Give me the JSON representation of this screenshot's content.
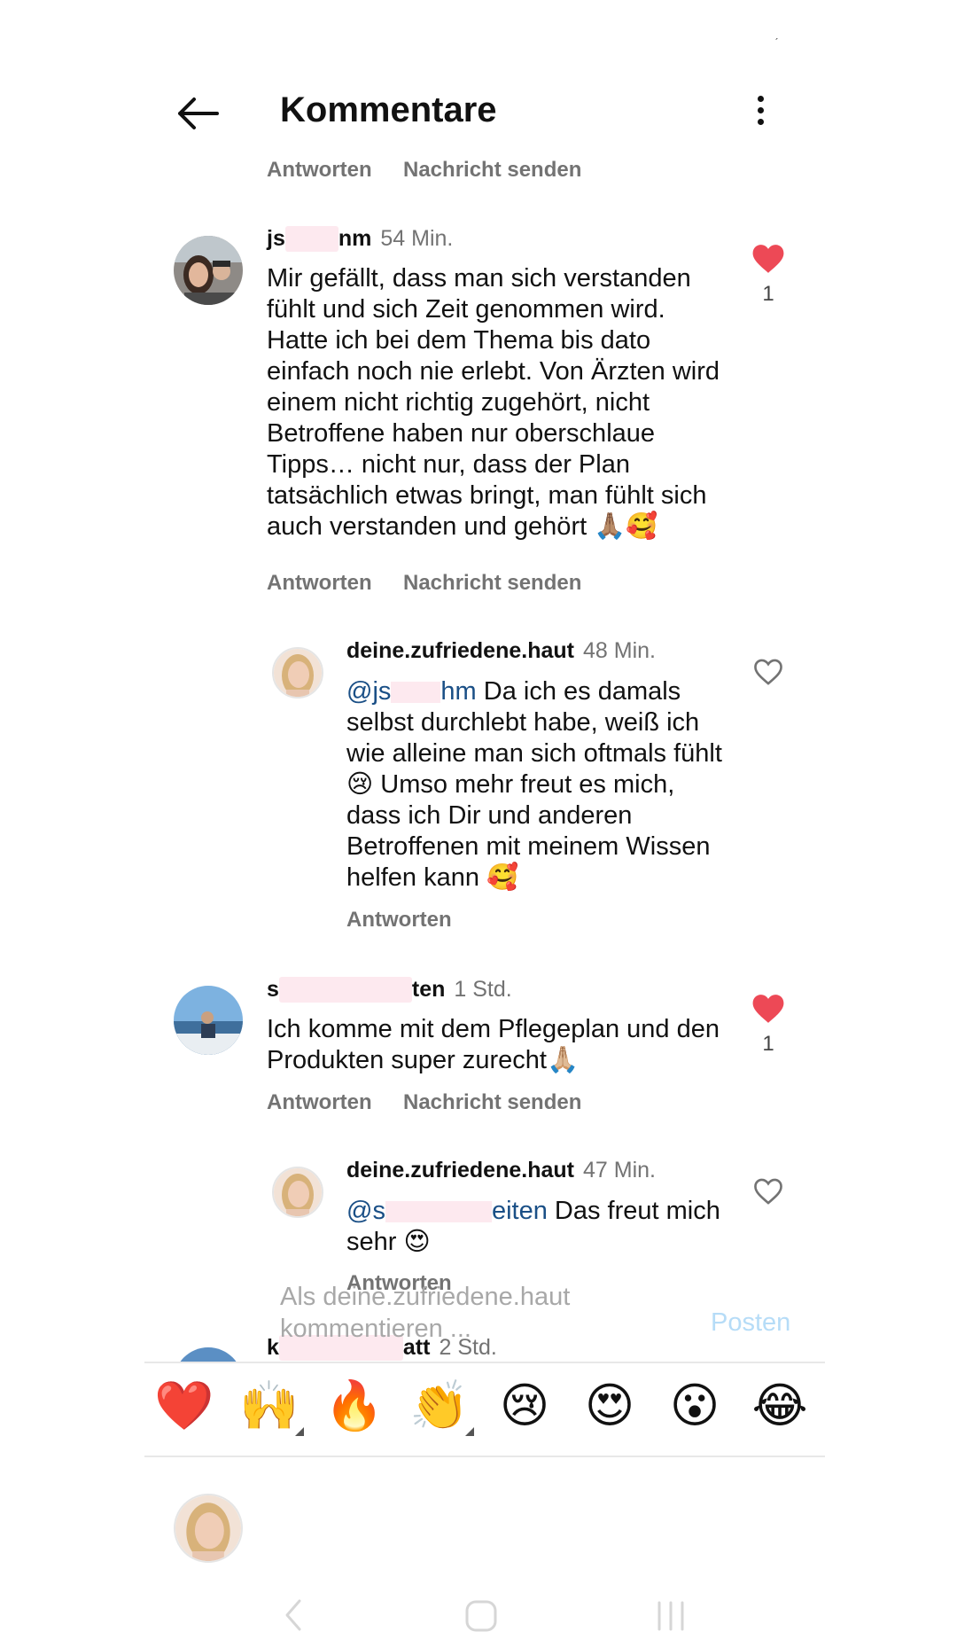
{
  "header": {
    "title": "Kommentare",
    "status_mark": "ˊ"
  },
  "top_actions": {
    "reply_label": "Antworten",
    "message_label": "Nachricht senden"
  },
  "comments": [
    {
      "user_visible_start": "js",
      "user_visible_end": "nm",
      "time": "54 Min.",
      "text": "Mir gefällt, dass man sich verstanden fühlt und sich Zeit genommen wird. Hatte ich bei dem Thema bis dato einfach noch nie erlebt. Von Ärzten wird einem nicht richtig zugehört, nicht Betroffene haben nur oberschlaue Tipps… nicht nur, dass der Plan tatsächlich etwas bringt, man fühlt sich auch verstanden und gehört 🙏🏽🥰",
      "likes": "1",
      "liked": true,
      "reply_label": "Antworten",
      "message_label": "Nachricht senden",
      "reply": {
        "user": "deine.zufriedene.haut",
        "time": "48 Min.",
        "mention_start": "@js",
        "mention_end": "hm",
        "text_before_emoji": "Da ich es damals selbst durchlebt habe, weiß ich wie alleine man sich oftmals fühlt 😢 Umso mehr freut es mich, dass ich Dir und anderen Betroffenen mit meinem Wissen helfen kann 🥰",
        "reply_label": "Antworten",
        "liked": false
      }
    },
    {
      "user_visible_start": "s",
      "user_visible_end": "ten",
      "time": "1 Std.",
      "text": "Ich komme mit dem Pflegeplan und den Produkten super zurecht🙏🏼",
      "likes": "1",
      "liked": true,
      "reply_label": "Antworten",
      "message_label": "Nachricht senden",
      "reply": {
        "user": "deine.zufriedene.haut",
        "time": "47 Min.",
        "mention_start": "@s",
        "mention_end": "eiten",
        "text_before_emoji": "Das freut mich sehr 😍",
        "reply_label": "Antworten",
        "liked": false
      }
    },
    {
      "user_visible_start": "k",
      "user_visible_end": "att",
      "time": "2 Std."
    }
  ],
  "emoji_bar": [
    "❤️",
    "🙌",
    "🔥",
    "👏",
    "😢",
    "😍",
    "😮",
    "😂"
  ],
  "composer": {
    "placeholder": "Als deine.zufriedene.haut kommentieren ...",
    "post_label": "Posten"
  },
  "colors": {
    "like_red": "#ed4956",
    "mention_blue": "#1a4f86",
    "secondary_text": "#737373",
    "post_disabled": "#b6dcf7"
  }
}
